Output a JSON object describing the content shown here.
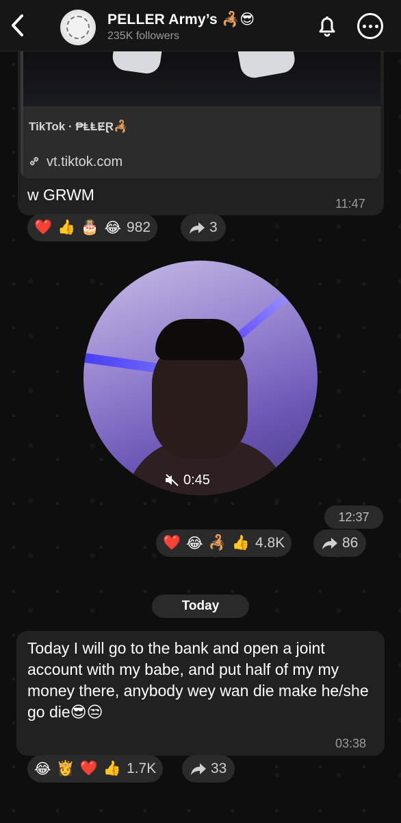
{
  "header": {
    "back_icon": "chevron-left-icon",
    "title": "PELLER Army’s 🦂😎",
    "followers": "235K followers",
    "bell_icon": "bell-icon",
    "more_icon": "more-icon"
  },
  "posts": [
    {
      "link_preview": {
        "site": "TikTok · ₱ⱠⱠɆⱤ🦂",
        "url": "vt.tiktok.com"
      },
      "text": "w GRWM",
      "time": "11:47",
      "reactions": {
        "emojis": [
          "❤️",
          "👍",
          "🎂",
          "😂"
        ],
        "count": "982"
      },
      "shares": "3"
    },
    {
      "video": {
        "duration": "0:45",
        "muted_icon": "speaker-muted-icon"
      },
      "time": "12:37",
      "reactions": {
        "emojis": [
          "❤️",
          "😂",
          "🦂",
          "👍"
        ],
        "count": "4.8K"
      },
      "shares": "86"
    }
  ],
  "date_separator": "Today",
  "message": {
    "text": "Today I will go to the bank and open a joint account with my babe, and put half of my my money there, anybody wey wan die make he/she go die😎😒",
    "time": "03:38",
    "reactions": {
      "emojis": [
        "😂",
        "👸",
        "❤️",
        "👍"
      ],
      "count": "1.7K"
    },
    "shares": "33"
  },
  "colors": {
    "background": "#0e0e0e",
    "bubble": "#212121",
    "pill": "#2a2a2a",
    "secondary_text": "#9a9a9a"
  }
}
